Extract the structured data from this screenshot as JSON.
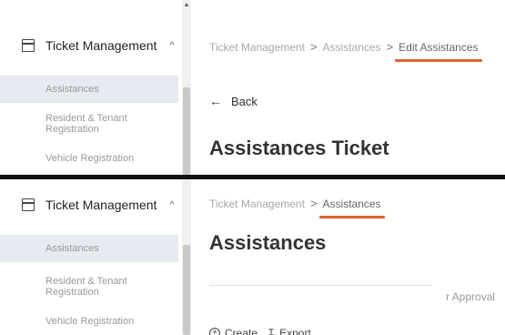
{
  "top": {
    "sidebar": {
      "group_label": "Ticket Management",
      "group_chevron": "chevron-up-icon",
      "items": [
        {
          "label": "Assistances",
          "active": true
        },
        {
          "label": "Resident & Tenant Registration",
          "active": false
        },
        {
          "label": "Vehicle Registration",
          "active": false
        }
      ]
    },
    "breadcrumb": [
      "Ticket Management",
      "Assistances",
      "Edit Assistances"
    ],
    "back_label": "Back",
    "title": "Assistances Ticket"
  },
  "bottom": {
    "sidebar": {
      "group_label": "Ticket Management",
      "group_chevron": "chevron-up-icon",
      "items": [
        {
          "label": "Assistances",
          "active": true
        },
        {
          "label": "Resident & Tenant Registration",
          "active": false
        },
        {
          "label": "Vehicle Registration",
          "active": false
        }
      ]
    },
    "breadcrumb": [
      "Ticket Management",
      "Assistances"
    ],
    "title": "Assistances",
    "partial_status": "r Approval",
    "create_label": "Create",
    "export_label": "Export"
  },
  "colors": {
    "accent_underline": "#d9652e",
    "active_item_bg": "#e8eaf1",
    "divider": "#111111"
  },
  "separator_glyph": ">"
}
